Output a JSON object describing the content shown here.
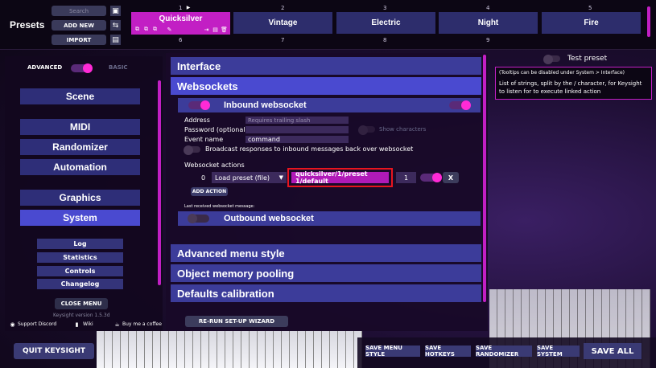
{
  "header": {
    "presets_label": "Presets",
    "search_placeholder": "Search",
    "add_new": "ADD NEW",
    "import": "IMPORT"
  },
  "presets": [
    {
      "num": "1",
      "name": "Quicksilver"
    },
    {
      "num": "2",
      "name": "Vintage"
    },
    {
      "num": "3",
      "name": "Electric"
    },
    {
      "num": "4",
      "name": "Night"
    },
    {
      "num": "5",
      "name": "Fire"
    }
  ],
  "presets_row2": [
    "6",
    "7",
    "8",
    "9"
  ],
  "sidebar": {
    "advanced": "ADVANCED",
    "basic": "BASIC",
    "items": [
      "Scene",
      "MIDI",
      "Randomizer",
      "Automation",
      "Graphics",
      "System"
    ],
    "subitems": [
      "Log",
      "Statistics",
      "Controls",
      "Changelog"
    ],
    "close_menu": "CLOSE MENU",
    "version": "Keysight version 1.5.3d",
    "support_discord": "Support Discord",
    "wiki": "Wiki",
    "buy_coffee": "Buy me a coffee"
  },
  "main": {
    "sections": [
      "Interface",
      "Websockets"
    ],
    "inbound": "Inbound websocket",
    "address_label": "Address",
    "address_placeholder": "Requires trailing slash",
    "password_label": "Password (optional)",
    "show_characters": "Show characters",
    "event_label": "Event name",
    "event_value": "command",
    "broadcast": "Broadcast responses to inbound messages back over websocket",
    "ws_actions": "Websocket actions",
    "action_index": "0",
    "action_type": "Load preset (file)",
    "action_value": "quicksilver/1/preset 1/default",
    "action_count": "1",
    "action_remove": "X",
    "add_action": "ADD ACTION",
    "last_received": "Last received websocket message:",
    "outbound": "Outbound websocket",
    "lower_sections": [
      "Advanced menu style",
      "Object memory pooling",
      "Defaults calibration"
    ],
    "rerun": "RE-RUN SET-UP WIZARD"
  },
  "right": {
    "test_preset": "Test preset",
    "tooltip_title": "(Tooltips can be disabled under System > Interface)",
    "tooltip_body": "List of strings, split by the / character, for Keysight to listen for to execute linked action"
  },
  "footer": {
    "quit": "QUIT KEYSIGHT",
    "save_menu_style": "SAVE MENU STYLE",
    "save_hotkeys": "SAVE HOTKEYS",
    "save_randomizer": "SAVE RANDOMIZER",
    "save_system": "SAVE SYSTEM",
    "save_all": "SAVE ALL"
  },
  "colors": {
    "accent": "#ff2ad6",
    "selected_preset": "#c21fc4",
    "highlight_border": "#e8151f"
  }
}
